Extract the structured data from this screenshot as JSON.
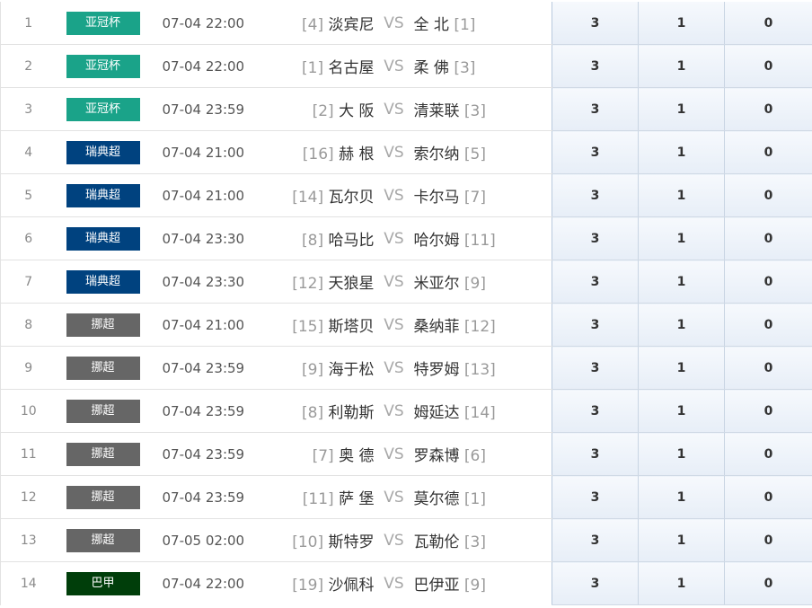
{
  "colors": {
    "亚冠杯": "#1aa389",
    "瑞典超": "#00427f",
    "挪超": "#666666",
    "巴甲": "#003e0a"
  },
  "matches": [
    {
      "num": "1",
      "league": "亚冠杯",
      "time": "07-04 22:00",
      "home_rank": "[4]",
      "home": "淡宾尼",
      "vs": "VS",
      "away": "全 北",
      "away_rank": "[1]",
      "p3": "3",
      "p1": "1",
      "p0": "0"
    },
    {
      "num": "2",
      "league": "亚冠杯",
      "time": "07-04 22:00",
      "home_rank": "[1]",
      "home": "名古屋",
      "vs": "VS",
      "away": "柔 佛",
      "away_rank": "[3]",
      "p3": "3",
      "p1": "1",
      "p0": "0"
    },
    {
      "num": "3",
      "league": "亚冠杯",
      "time": "07-04 23:59",
      "home_rank": "[2]",
      "home": "大 阪",
      "vs": "VS",
      "away": "清莱联",
      "away_rank": "[3]",
      "p3": "3",
      "p1": "1",
      "p0": "0"
    },
    {
      "num": "4",
      "league": "瑞典超",
      "time": "07-04 21:00",
      "home_rank": "[16]",
      "home": "赫 根",
      "vs": "VS",
      "away": "索尔纳",
      "away_rank": "[5]",
      "p3": "3",
      "p1": "1",
      "p0": "0"
    },
    {
      "num": "5",
      "league": "瑞典超",
      "time": "07-04 21:00",
      "home_rank": "[14]",
      "home": "瓦尔贝",
      "vs": "VS",
      "away": "卡尔马",
      "away_rank": "[7]",
      "p3": "3",
      "p1": "1",
      "p0": "0"
    },
    {
      "num": "6",
      "league": "瑞典超",
      "time": "07-04 23:30",
      "home_rank": "[8]",
      "home": "哈马比",
      "vs": "VS",
      "away": "哈尔姆",
      "away_rank": "[11]",
      "p3": "3",
      "p1": "1",
      "p0": "0"
    },
    {
      "num": "7",
      "league": "瑞典超",
      "time": "07-04 23:30",
      "home_rank": "[12]",
      "home": "天狼星",
      "vs": "VS",
      "away": "米亚尔",
      "away_rank": "[9]",
      "p3": "3",
      "p1": "1",
      "p0": "0"
    },
    {
      "num": "8",
      "league": "挪超",
      "time": "07-04 21:00",
      "home_rank": "[15]",
      "home": "斯塔贝",
      "vs": "VS",
      "away": "桑纳菲",
      "away_rank": "[12]",
      "p3": "3",
      "p1": "1",
      "p0": "0"
    },
    {
      "num": "9",
      "league": "挪超",
      "time": "07-04 23:59",
      "home_rank": "[9]",
      "home": "海于松",
      "vs": "VS",
      "away": "特罗姆",
      "away_rank": "[13]",
      "p3": "3",
      "p1": "1",
      "p0": "0"
    },
    {
      "num": "10",
      "league": "挪超",
      "time": "07-04 23:59",
      "home_rank": "[8]",
      "home": "利勒斯",
      "vs": "VS",
      "away": "姆延达",
      "away_rank": "[14]",
      "p3": "3",
      "p1": "1",
      "p0": "0"
    },
    {
      "num": "11",
      "league": "挪超",
      "time": "07-04 23:59",
      "home_rank": "[7]",
      "home": "奥 德",
      "vs": "VS",
      "away": "罗森博",
      "away_rank": "[6]",
      "p3": "3",
      "p1": "1",
      "p0": "0"
    },
    {
      "num": "12",
      "league": "挪超",
      "time": "07-04 23:59",
      "home_rank": "[11]",
      "home": "萨 堡",
      "vs": "VS",
      "away": "莫尔德",
      "away_rank": "[1]",
      "p3": "3",
      "p1": "1",
      "p0": "0"
    },
    {
      "num": "13",
      "league": "挪超",
      "time": "07-05 02:00",
      "home_rank": "[10]",
      "home": "斯特罗",
      "vs": "VS",
      "away": "瓦勒伦",
      "away_rank": "[3]",
      "p3": "3",
      "p1": "1",
      "p0": "0"
    },
    {
      "num": "14",
      "league": "巴甲",
      "time": "07-04 22:00",
      "home_rank": "[19]",
      "home": "沙佩科",
      "vs": "VS",
      "away": "巴伊亚",
      "away_rank": "[9]",
      "p3": "3",
      "p1": "1",
      "p0": "0"
    }
  ]
}
